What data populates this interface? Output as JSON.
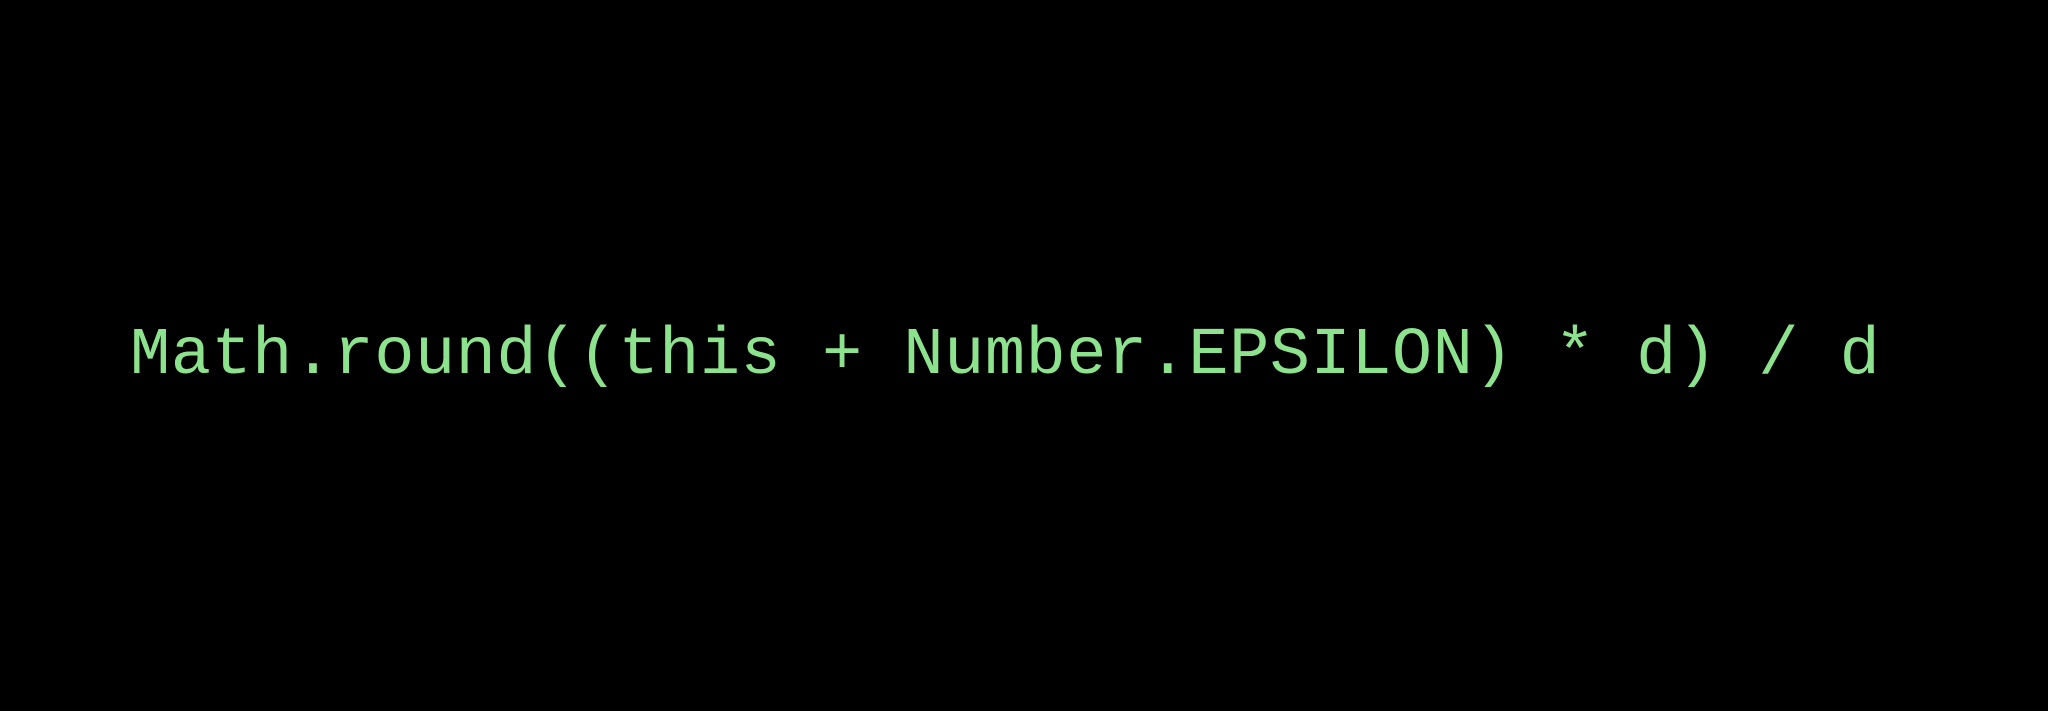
{
  "code": {
    "line": "Math.round((this + Number.EPSILON) * d) / d"
  }
}
